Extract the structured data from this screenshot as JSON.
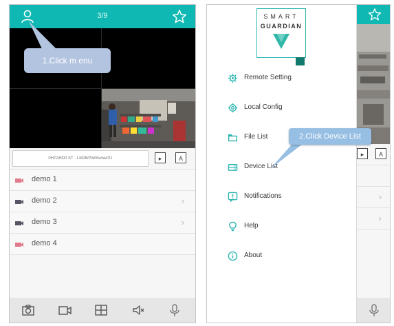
{
  "left_screen": {
    "page_indicator": "3/9",
    "callout": "1.Click m enu",
    "device_id_text": "0H7AHD0 ST · LM26/Pw0kwwvr01",
    "mode_buttons": [
      "▸",
      "A"
    ],
    "devices": [
      {
        "name": "demo 1",
        "icon": "camera-pink-icon",
        "has_chevron": false
      },
      {
        "name": "demo 2",
        "icon": "camera-gray-icon",
        "has_chevron": true
      },
      {
        "name": "demo 3",
        "icon": "camera-gray-icon",
        "has_chevron": true
      },
      {
        "name": "demo 4",
        "icon": "camera-pink-icon",
        "has_chevron": false
      }
    ],
    "chevron": "›",
    "bottom_icons": [
      "camera-icon",
      "video-icon",
      "grid-icon",
      "mute-icon",
      "microphone-icon"
    ]
  },
  "right_screen": {
    "logo": {
      "line1": "SMART",
      "line2": "GUARDIAN"
    },
    "menu": [
      {
        "label": "Remote Setting",
        "icon": "gear-icon"
      },
      {
        "label": "Local Config",
        "icon": "settings-icon"
      },
      {
        "label": "File List",
        "icon": "folder-icon"
      },
      {
        "label": "Device List",
        "icon": "device-icon"
      },
      {
        "label": "Notifications",
        "icon": "notification-icon"
      },
      {
        "label": "Help",
        "icon": "help-icon"
      },
      {
        "label": "About",
        "icon": "info-icon"
      }
    ],
    "callout": "2.Click Device List"
  },
  "colors": {
    "accent": "#0fb8b2",
    "callout1": "#b3c4e0",
    "callout2": "#97bfe3",
    "menu_icon": "#2bb5b0"
  }
}
